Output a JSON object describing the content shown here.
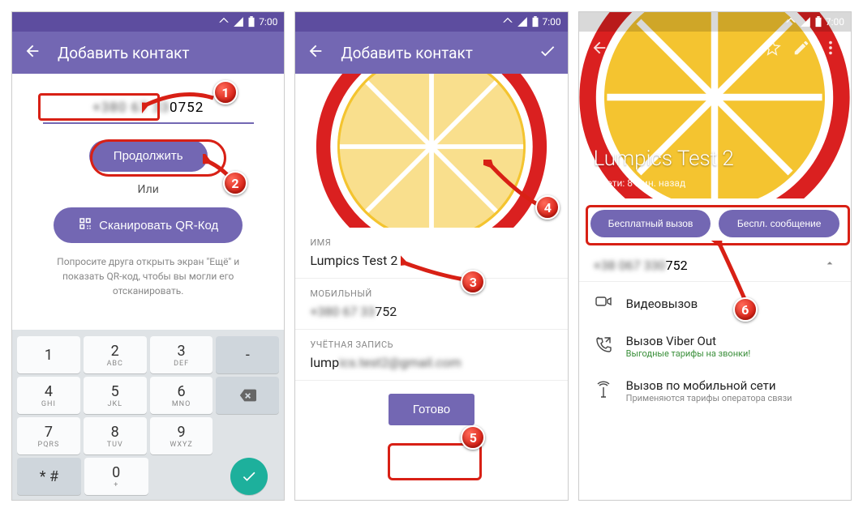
{
  "status": {
    "time": "7:00"
  },
  "markers": {
    "m1": "1",
    "m2": "2",
    "m3": "3",
    "m4": "4",
    "m5": "5",
    "m6": "6"
  },
  "screen1": {
    "title": "Добавить контакт",
    "phone_hidden": "+380 67 33",
    "phone_visible": "0752",
    "continue_btn": "Продолжить",
    "or": "Или",
    "scan_btn": "Сканировать QR-Код",
    "helper": "Попросите друга открыть экран \"Ещё\" и показать QR-код, чтобы вы могли его отсканировать.",
    "keypad": {
      "r1": [
        {
          "n": "1",
          "l": ""
        },
        {
          "n": "2",
          "l": "ABC"
        },
        {
          "n": "3",
          "l": "DEF"
        }
      ],
      "r2": [
        {
          "n": "4",
          "l": "GHI"
        },
        {
          "n": "5",
          "l": "JKL"
        },
        {
          "n": "6",
          "l": "MNO"
        }
      ],
      "r3": [
        {
          "n": "7",
          "l": "PQRS"
        },
        {
          "n": "8",
          "l": "TUV"
        },
        {
          "n": "9",
          "l": "WXYZ"
        }
      ],
      "r4": {
        "star": "* #",
        "zero": "0",
        "zletters": "+"
      }
    }
  },
  "screen2": {
    "title": "Добавить контакт",
    "name_label": "ИМЯ",
    "name_value": "Lumpics Test 2",
    "mobile_label": "МОБИЛЬНЫЙ",
    "mobile_hidden": "+380 67 33",
    "mobile_visible": "752",
    "account_label": "УЧЁТНАЯ ЗАПИСЬ",
    "account_prefix": "lump",
    "account_hidden": "ics.test2@gmail.com",
    "done_btn": "Готово"
  },
  "screen3": {
    "name": "Lumpics Test 2",
    "status": "В сети: 8 мин. назад",
    "free_call": "Бесплатный вызов",
    "free_msg": "Беспл. сообщение",
    "number_hidden": "+38 067 330",
    "number_visible": "752",
    "video_call": "Видеовызов",
    "viber_out_title": "Вызов Viber Out",
    "viber_out_sub": "Выгодные тарифы на звонки!",
    "cell_title": "Вызов по мобильной сети",
    "cell_sub": "Применяются тарифы оператора связи"
  }
}
